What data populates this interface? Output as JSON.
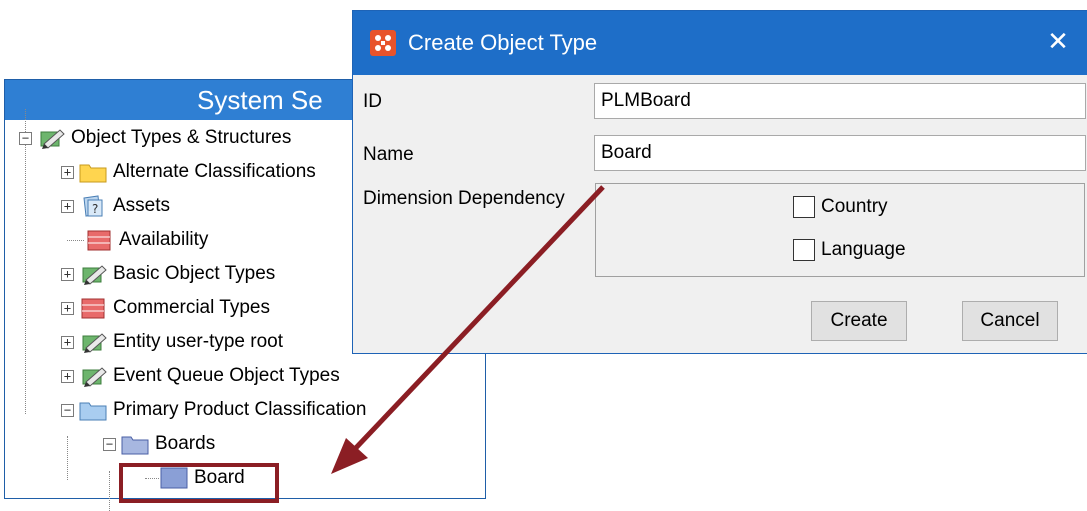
{
  "panel": {
    "header": "System Se",
    "tree": [
      {
        "label": "Object Types & Structures",
        "icon": "object-types-icon",
        "expander": "−"
      },
      {
        "label": "Alternate Classifications",
        "icon": "folder-yellow-icon",
        "expander": "+"
      },
      {
        "label": "Assets",
        "icon": "assets-icon",
        "expander": "+"
      },
      {
        "label": "Availability",
        "icon": "table-red-icon",
        "expander": ""
      },
      {
        "label": "Basic Object Types",
        "icon": "object-types-icon",
        "expander": "+"
      },
      {
        "label": "Commercial Types",
        "icon": "table-red-icon",
        "expander": "+"
      },
      {
        "label": "Entity user-type root",
        "icon": "object-types-icon",
        "expander": "+"
      },
      {
        "label": "Event Queue Object Types",
        "icon": "object-types-icon",
        "expander": "+"
      },
      {
        "label": "Primary Product Classification",
        "icon": "folder-blue-icon",
        "expander": "−"
      },
      {
        "label": "Boards",
        "icon": "folder-blue-icon",
        "expander": "−"
      },
      {
        "label": "Board",
        "icon": "object-blue-icon",
        "expander": ""
      }
    ]
  },
  "dialog": {
    "title": "Create Object Type",
    "close_glyph": "✕",
    "fields": {
      "id": {
        "label": "ID",
        "value": "PLMBoard"
      },
      "name": {
        "label": "Name",
        "value": "Board"
      },
      "dimension": {
        "label": "Dimension Dependency"
      }
    },
    "checkboxes": [
      {
        "label": "Country",
        "checked": false
      },
      {
        "label": "Language",
        "checked": false
      }
    ],
    "buttons": {
      "create": "Create",
      "cancel": "Cancel"
    }
  },
  "colors": {
    "accent": "#1e6ec8",
    "arrow": "#8b1e24",
    "app_icon": "#e8532b"
  }
}
